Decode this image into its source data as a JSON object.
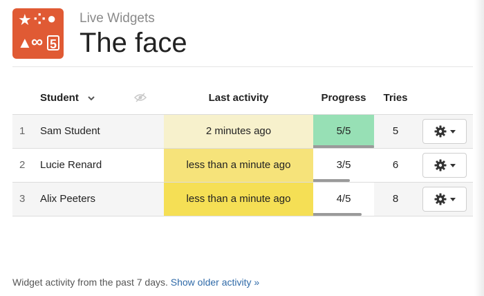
{
  "header": {
    "app_name": "Live Widgets",
    "title": "The face",
    "icon_glyphs": [
      "★",
      "⁘",
      "●",
      "▲",
      "∞",
      "5"
    ],
    "icon_color": "#e05a34"
  },
  "table": {
    "columns": {
      "student": "Student",
      "last_activity": "Last activity",
      "progress": "Progress",
      "tries": "Tries"
    },
    "rows": [
      {
        "num": "1",
        "name": "Sam Student",
        "activity": "2 minutes ago",
        "activity_color": "#f7f1cc",
        "progress": "5/5",
        "progress_fraction": 1.0,
        "progress_color": "#97e0b5",
        "tries": "5"
      },
      {
        "num": "2",
        "name": "Lucie Renard",
        "activity": "less than a minute ago",
        "activity_color": "#f6e37a",
        "progress": "3/5",
        "progress_fraction": 0.6,
        "progress_color": "#ffffff",
        "tries": "6"
      },
      {
        "num": "3",
        "name": "Alix Peeters",
        "activity": "less than a minute ago",
        "activity_color": "#f5df55",
        "progress": "4/5",
        "progress_fraction": 0.8,
        "progress_color": "#ffffff",
        "tries": "8"
      }
    ]
  },
  "footer": {
    "text": "Widget activity from the past 7 days.",
    "link": "Show older activity »"
  }
}
